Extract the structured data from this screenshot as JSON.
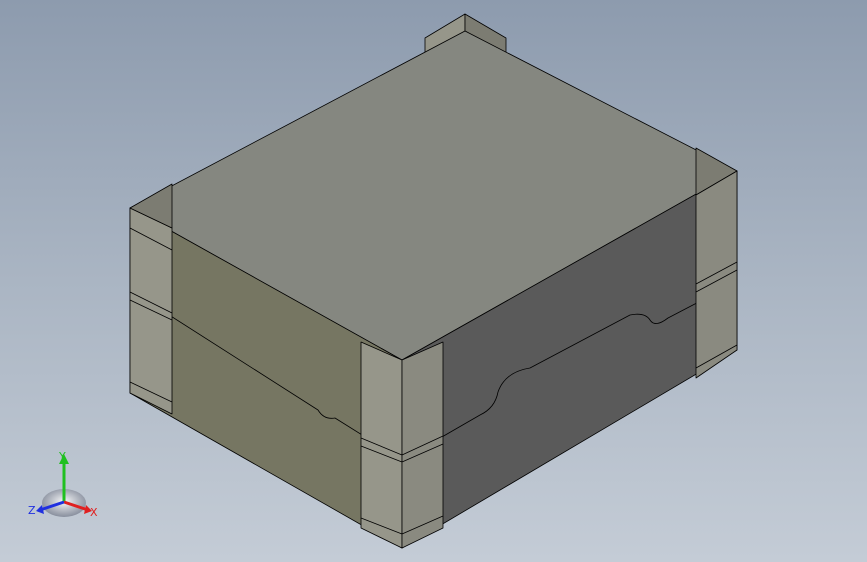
{
  "viewport": {
    "background_top": "#8d9bae",
    "background_bottom": "#c4ccd6"
  },
  "model": {
    "top_face_color": "#858780",
    "front_face_color": "#767662",
    "right_face_color": "#5a5a5a",
    "bracket_face_color": "#96968a",
    "bracket_side_color": "#6e6e6e",
    "edge_color": "#000000"
  },
  "triad": {
    "x_label": "X",
    "y_label": "Y",
    "z_label": "Z",
    "x_color": "#e02020",
    "y_color": "#20c020",
    "z_color": "#2030e0"
  }
}
